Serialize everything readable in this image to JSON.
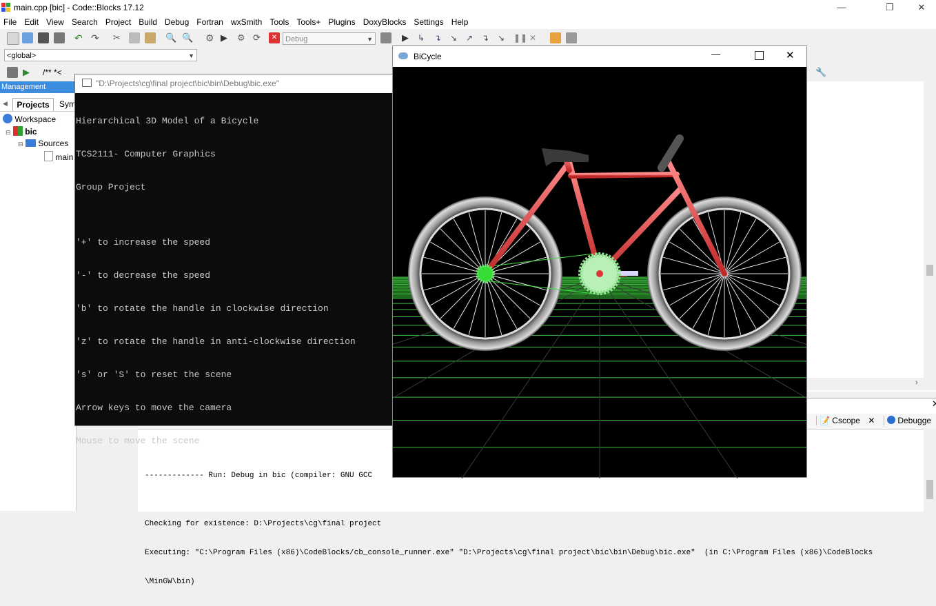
{
  "app": {
    "title": "main.cpp [bic] - Code::Blocks 17.12"
  },
  "window_controls": {
    "minimize": "—",
    "restore": "❐",
    "close": "✕"
  },
  "menu": [
    "File",
    "Edit",
    "View",
    "Search",
    "Project",
    "Build",
    "Debug",
    "Fortran",
    "wxSmith",
    "Tools",
    "Tools+",
    "Plugins",
    "DoxyBlocks",
    "Settings",
    "Help"
  ],
  "toolbar": {
    "build_target": "Debug",
    "scope": "<global>",
    "doxy_comment": "/** *<"
  },
  "management": {
    "header": "Management",
    "tabs": [
      "Projects",
      "Sym"
    ],
    "tree": {
      "workspace": "Workspace",
      "project": "bic",
      "folder": "Sources",
      "file": "main"
    }
  },
  "console": {
    "title": "\"D:\\Projects\\cg\\final project\\bic\\bin\\Debug\\bic.exe\"",
    "lines": [
      "Hierarchical 3D Model of a Bicycle",
      "TCS2111- Computer Graphics",
      "Group Project",
      "",
      "'+' to increase the speed",
      "'-' to decrease the speed",
      "'b' to rotate the handle in clockwise direction",
      "'z' to rotate the handle in anti-clockwise direction",
      "'s' or 'S' to reset the scene",
      "Arrow keys to move the camera",
      "Mouse to move the scene"
    ]
  },
  "bike_window": {
    "title": "BiCycle"
  },
  "logs": {
    "tabs": [
      "Cscope",
      "Debugge"
    ],
    "lines": [
      "------------- Run: Debug in bic (compiler: GNU GCC",
      "",
      "Checking for existence: D:\\Projects\\cg\\final project",
      "Executing: \"C:\\Program Files (x86)\\CodeBlocks/cb_console_runner.exe\" \"D:\\Projects\\cg\\final project\\bic\\bin\\Debug\\bic.exe\"  (in C:\\Program Files (x86)\\CodeBlocks",
      "\\MinGW\\bin)"
    ]
  },
  "colors": {
    "accent": "#3c8de0",
    "frame": "#e84848",
    "sprocket": "#7fe07f",
    "grid": "#3fbf3f"
  }
}
